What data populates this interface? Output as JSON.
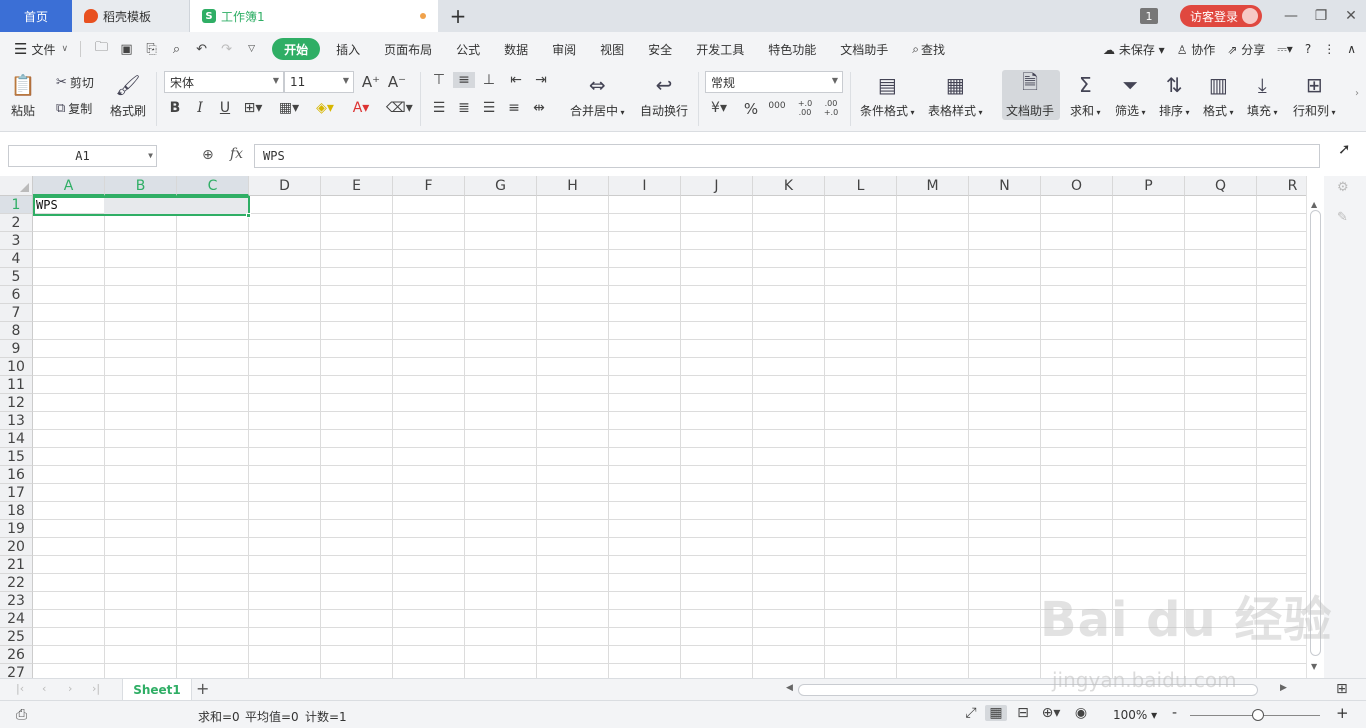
{
  "tabs": {
    "home": "首页",
    "daoke": "稻壳模板",
    "workbook": "工作簿1",
    "workbook_icon_letter": "S",
    "new_tab": "+"
  },
  "titlebar": {
    "window_count": "1",
    "login": "访客登录",
    "minimize": "—",
    "restore": "❐",
    "close": "✕"
  },
  "menu": {
    "file": "文件",
    "tabs": [
      "开始",
      "插入",
      "页面布局",
      "公式",
      "数据",
      "审阅",
      "视图",
      "安全",
      "开发工具",
      "特色功能",
      "文档助手"
    ],
    "search": "查找",
    "unsaved": "未保存",
    "collab": "协作",
    "share": "分享",
    "help": "?"
  },
  "ribbon": {
    "paste": "粘贴",
    "cut": "剪切",
    "copy": "复制",
    "format_painter": "格式刷",
    "font_name": "宋体",
    "font_size": "11",
    "bold": "B",
    "italic": "I",
    "underline": "U",
    "merge_center": "合并居中",
    "wrap_text": "自动换行",
    "number_format": "常规",
    "percent": "%",
    "thousands": "000",
    "inc_decimal": "+.0 .00",
    "dec_decimal": ".00 +.0",
    "conditional_format": "条件格式",
    "table_style": "表格样式",
    "doc_helper": "文档助手",
    "sum": "求和",
    "filter": "筛选",
    "sort": "排序",
    "format": "格式",
    "fill": "填充",
    "rows_cols": "行和列"
  },
  "formula_bar": {
    "name_box": "A1",
    "fx": "fx",
    "value": "WPS"
  },
  "grid": {
    "columns": [
      "A",
      "B",
      "C",
      "D",
      "E",
      "F",
      "G",
      "H",
      "I",
      "J",
      "K",
      "L",
      "M",
      "N",
      "O",
      "P",
      "Q",
      "R"
    ],
    "rows": [
      "1",
      "2",
      "3",
      "4",
      "5",
      "6",
      "7",
      "8",
      "9",
      "10",
      "11",
      "12",
      "13",
      "14",
      "15",
      "16",
      "17",
      "18",
      "19",
      "20",
      "21",
      "22",
      "23",
      "24",
      "25",
      "26",
      "27"
    ],
    "cell_A1": "WPS",
    "selected_columns": [
      "A",
      "B",
      "C"
    ],
    "selected_row": "1"
  },
  "sheets": {
    "active": "Sheet1",
    "add": "+"
  },
  "status": {
    "sum": "求和=0",
    "average": "平均值=0",
    "count": "计数=1",
    "zoom": "100%",
    "zoom_minus": "-",
    "zoom_plus": "+"
  },
  "watermark": {
    "text": "Bai du 经验",
    "url": "jingyan.baidu.com"
  },
  "colors": {
    "accent_green": "#2fae65",
    "home_tab_blue": "#3b6fd6",
    "login_red": "#e0483f"
  }
}
